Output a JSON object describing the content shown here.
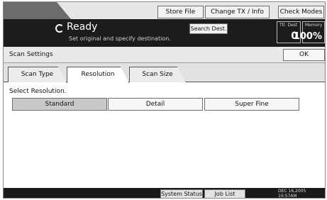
{
  "header": {
    "buttons": {
      "store_file": "Store File",
      "change_tx_info": "Change TX / Info",
      "check_modes": "Check Modes"
    },
    "status": {
      "title": "Ready",
      "subtitle": "Set original and specify destination."
    },
    "search_dest": "Search Dest.",
    "counters": {
      "ttl_dest_label": "Ttl. Dest",
      "ttl_dest_value": "0",
      "memory_label": "Memory",
      "memory_value": "100%"
    }
  },
  "scan_settings": {
    "title": "Scan Settings",
    "ok": "OK",
    "tabs": [
      {
        "label": "Scan Type",
        "active": false
      },
      {
        "label": "Resolution",
        "active": true
      },
      {
        "label": "Scan Size",
        "active": false
      }
    ],
    "section_label": "Select Resolution.",
    "options": [
      {
        "label": "Standard",
        "selected": true
      },
      {
        "label": "Detail",
        "selected": false
      },
      {
        "label": "Super Fine",
        "selected": false
      }
    ]
  },
  "footer": {
    "system_status": "System Status",
    "job_list": "Job List",
    "date": "DEC  16,2005",
    "time": "10:57AM"
  }
}
